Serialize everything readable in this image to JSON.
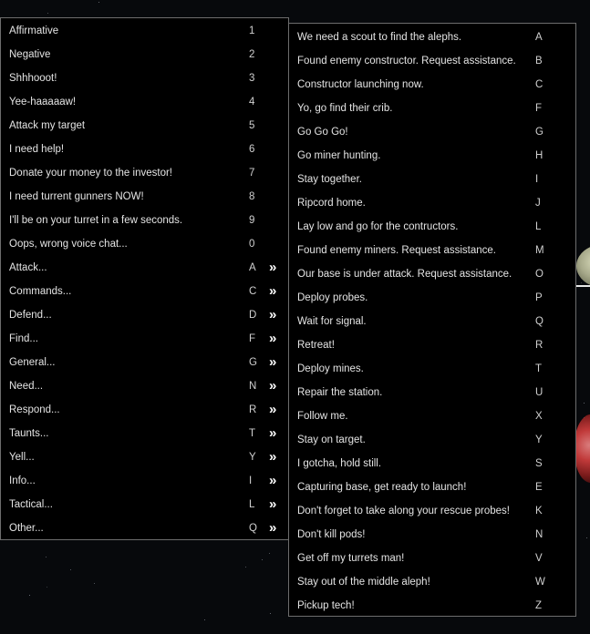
{
  "left_menu": {
    "items": [
      {
        "label": "Affirmative",
        "key": "1",
        "submenu": false
      },
      {
        "label": "Negative",
        "key": "2",
        "submenu": false
      },
      {
        "label": "Shhhooot!",
        "key": "3",
        "submenu": false
      },
      {
        "label": "Yee-haaaaaw!",
        "key": "4",
        "submenu": false
      },
      {
        "label": "Attack my target",
        "key": "5",
        "submenu": false
      },
      {
        "label": "I need help!",
        "key": "6",
        "submenu": false
      },
      {
        "label": "Donate your money to the investor!",
        "key": "7",
        "submenu": false
      },
      {
        "label": "I need turrent gunners NOW!",
        "key": "8",
        "submenu": false
      },
      {
        "label": "I'll be on your turret in a few seconds.",
        "key": "9",
        "submenu": false
      },
      {
        "label": "Oops, wrong voice chat...",
        "key": "0",
        "submenu": false
      },
      {
        "label": "Attack...",
        "key": "A",
        "submenu": true
      },
      {
        "label": "Commands...",
        "key": "C",
        "submenu": true
      },
      {
        "label": "Defend...",
        "key": "D",
        "submenu": true
      },
      {
        "label": "Find...",
        "key": "F",
        "submenu": true
      },
      {
        "label": "General...",
        "key": "G",
        "submenu": true
      },
      {
        "label": "Need...",
        "key": "N",
        "submenu": true
      },
      {
        "label": "Respond...",
        "key": "R",
        "submenu": true
      },
      {
        "label": "Taunts...",
        "key": "T",
        "submenu": true
      },
      {
        "label": "Yell...",
        "key": "Y",
        "submenu": true
      },
      {
        "label": "Info...",
        "key": "I",
        "submenu": true
      },
      {
        "label": "Tactical...",
        "key": "L",
        "submenu": true
      },
      {
        "label": "Other...",
        "key": "Q",
        "submenu": true
      }
    ],
    "submenu_arrow": "»"
  },
  "right_menu": {
    "items": [
      {
        "label": "We need a scout to find the alephs.",
        "key": "A"
      },
      {
        "label": "Found enemy constructor. Request assistance.",
        "key": "B"
      },
      {
        "label": "Constructor launching now.",
        "key": "C"
      },
      {
        "label": "Yo, go find their crib.",
        "key": "F"
      },
      {
        "label": "Go Go Go!",
        "key": "G"
      },
      {
        "label": "Go miner hunting.",
        "key": "H"
      },
      {
        "label": "Stay together.",
        "key": "I"
      },
      {
        "label": "Ripcord home.",
        "key": "J"
      },
      {
        "label": "Lay low and go for the contructors.",
        "key": "L"
      },
      {
        "label": "Found enemy miners. Request assistance.",
        "key": "M"
      },
      {
        "label": "Our base is under attack. Request assistance.",
        "key": "O"
      },
      {
        "label": "Deploy probes.",
        "key": "P"
      },
      {
        "label": "Wait for signal.",
        "key": "Q"
      },
      {
        "label": "Retreat!",
        "key": "R"
      },
      {
        "label": "Deploy mines.",
        "key": "T"
      },
      {
        "label": "Repair the station.",
        "key": "U"
      },
      {
        "label": "Follow me.",
        "key": "X"
      },
      {
        "label": "Stay on target.",
        "key": "Y"
      },
      {
        "label": "I gotcha, hold still.",
        "key": "S"
      },
      {
        "label": "Capturing base, get ready to launch!",
        "key": "E"
      },
      {
        "label": "Don't forget to take along your rescue probes!",
        "key": "K"
      },
      {
        "label": "Don't kill pods!",
        "key": "N"
      },
      {
        "label": "Get off my turrets man!",
        "key": "V"
      },
      {
        "label": "Stay out of the middle aleph!",
        "key": "W"
      },
      {
        "label": "Pickup tech!",
        "key": "Z"
      }
    ]
  }
}
